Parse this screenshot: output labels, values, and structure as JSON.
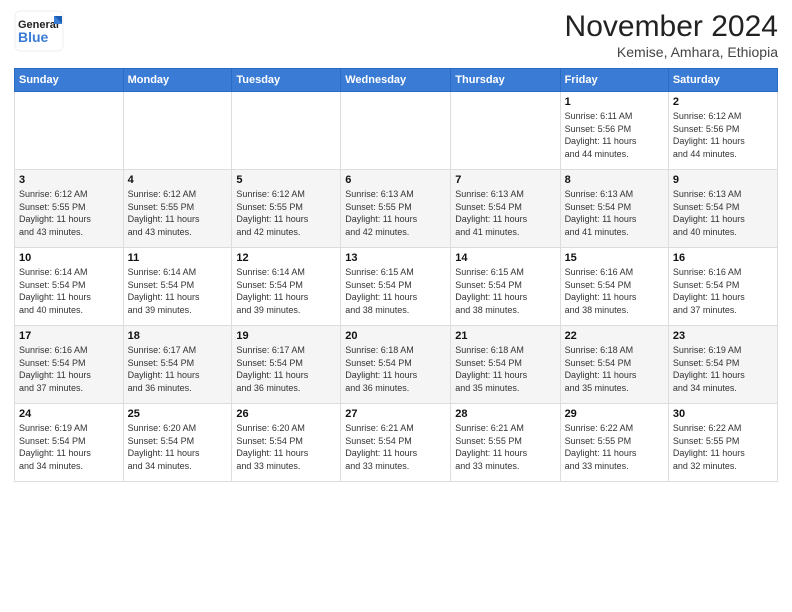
{
  "header": {
    "logo_line1": "General",
    "logo_line2": "Blue",
    "month_title": "November 2024",
    "subtitle": "Kemise, Amhara, Ethiopia"
  },
  "weekdays": [
    "Sunday",
    "Monday",
    "Tuesday",
    "Wednesday",
    "Thursday",
    "Friday",
    "Saturday"
  ],
  "weeks": [
    [
      {
        "day": "",
        "info": ""
      },
      {
        "day": "",
        "info": ""
      },
      {
        "day": "",
        "info": ""
      },
      {
        "day": "",
        "info": ""
      },
      {
        "day": "",
        "info": ""
      },
      {
        "day": "1",
        "info": "Sunrise: 6:11 AM\nSunset: 5:56 PM\nDaylight: 11 hours\nand 44 minutes."
      },
      {
        "day": "2",
        "info": "Sunrise: 6:12 AM\nSunset: 5:56 PM\nDaylight: 11 hours\nand 44 minutes."
      }
    ],
    [
      {
        "day": "3",
        "info": "Sunrise: 6:12 AM\nSunset: 5:55 PM\nDaylight: 11 hours\nand 43 minutes."
      },
      {
        "day": "4",
        "info": "Sunrise: 6:12 AM\nSunset: 5:55 PM\nDaylight: 11 hours\nand 43 minutes."
      },
      {
        "day": "5",
        "info": "Sunrise: 6:12 AM\nSunset: 5:55 PM\nDaylight: 11 hours\nand 42 minutes."
      },
      {
        "day": "6",
        "info": "Sunrise: 6:13 AM\nSunset: 5:55 PM\nDaylight: 11 hours\nand 42 minutes."
      },
      {
        "day": "7",
        "info": "Sunrise: 6:13 AM\nSunset: 5:54 PM\nDaylight: 11 hours\nand 41 minutes."
      },
      {
        "day": "8",
        "info": "Sunrise: 6:13 AM\nSunset: 5:54 PM\nDaylight: 11 hours\nand 41 minutes."
      },
      {
        "day": "9",
        "info": "Sunrise: 6:13 AM\nSunset: 5:54 PM\nDaylight: 11 hours\nand 40 minutes."
      }
    ],
    [
      {
        "day": "10",
        "info": "Sunrise: 6:14 AM\nSunset: 5:54 PM\nDaylight: 11 hours\nand 40 minutes."
      },
      {
        "day": "11",
        "info": "Sunrise: 6:14 AM\nSunset: 5:54 PM\nDaylight: 11 hours\nand 39 minutes."
      },
      {
        "day": "12",
        "info": "Sunrise: 6:14 AM\nSunset: 5:54 PM\nDaylight: 11 hours\nand 39 minutes."
      },
      {
        "day": "13",
        "info": "Sunrise: 6:15 AM\nSunset: 5:54 PM\nDaylight: 11 hours\nand 38 minutes."
      },
      {
        "day": "14",
        "info": "Sunrise: 6:15 AM\nSunset: 5:54 PM\nDaylight: 11 hours\nand 38 minutes."
      },
      {
        "day": "15",
        "info": "Sunrise: 6:16 AM\nSunset: 5:54 PM\nDaylight: 11 hours\nand 38 minutes."
      },
      {
        "day": "16",
        "info": "Sunrise: 6:16 AM\nSunset: 5:54 PM\nDaylight: 11 hours\nand 37 minutes."
      }
    ],
    [
      {
        "day": "17",
        "info": "Sunrise: 6:16 AM\nSunset: 5:54 PM\nDaylight: 11 hours\nand 37 minutes."
      },
      {
        "day": "18",
        "info": "Sunrise: 6:17 AM\nSunset: 5:54 PM\nDaylight: 11 hours\nand 36 minutes."
      },
      {
        "day": "19",
        "info": "Sunrise: 6:17 AM\nSunset: 5:54 PM\nDaylight: 11 hours\nand 36 minutes."
      },
      {
        "day": "20",
        "info": "Sunrise: 6:18 AM\nSunset: 5:54 PM\nDaylight: 11 hours\nand 36 minutes."
      },
      {
        "day": "21",
        "info": "Sunrise: 6:18 AM\nSunset: 5:54 PM\nDaylight: 11 hours\nand 35 minutes."
      },
      {
        "day": "22",
        "info": "Sunrise: 6:18 AM\nSunset: 5:54 PM\nDaylight: 11 hours\nand 35 minutes."
      },
      {
        "day": "23",
        "info": "Sunrise: 6:19 AM\nSunset: 5:54 PM\nDaylight: 11 hours\nand 34 minutes."
      }
    ],
    [
      {
        "day": "24",
        "info": "Sunrise: 6:19 AM\nSunset: 5:54 PM\nDaylight: 11 hours\nand 34 minutes."
      },
      {
        "day": "25",
        "info": "Sunrise: 6:20 AM\nSunset: 5:54 PM\nDaylight: 11 hours\nand 34 minutes."
      },
      {
        "day": "26",
        "info": "Sunrise: 6:20 AM\nSunset: 5:54 PM\nDaylight: 11 hours\nand 33 minutes."
      },
      {
        "day": "27",
        "info": "Sunrise: 6:21 AM\nSunset: 5:54 PM\nDaylight: 11 hours\nand 33 minutes."
      },
      {
        "day": "28",
        "info": "Sunrise: 6:21 AM\nSunset: 5:55 PM\nDaylight: 11 hours\nand 33 minutes."
      },
      {
        "day": "29",
        "info": "Sunrise: 6:22 AM\nSunset: 5:55 PM\nDaylight: 11 hours\nand 33 minutes."
      },
      {
        "day": "30",
        "info": "Sunrise: 6:22 AM\nSunset: 5:55 PM\nDaylight: 11 hours\nand 32 minutes."
      }
    ]
  ]
}
